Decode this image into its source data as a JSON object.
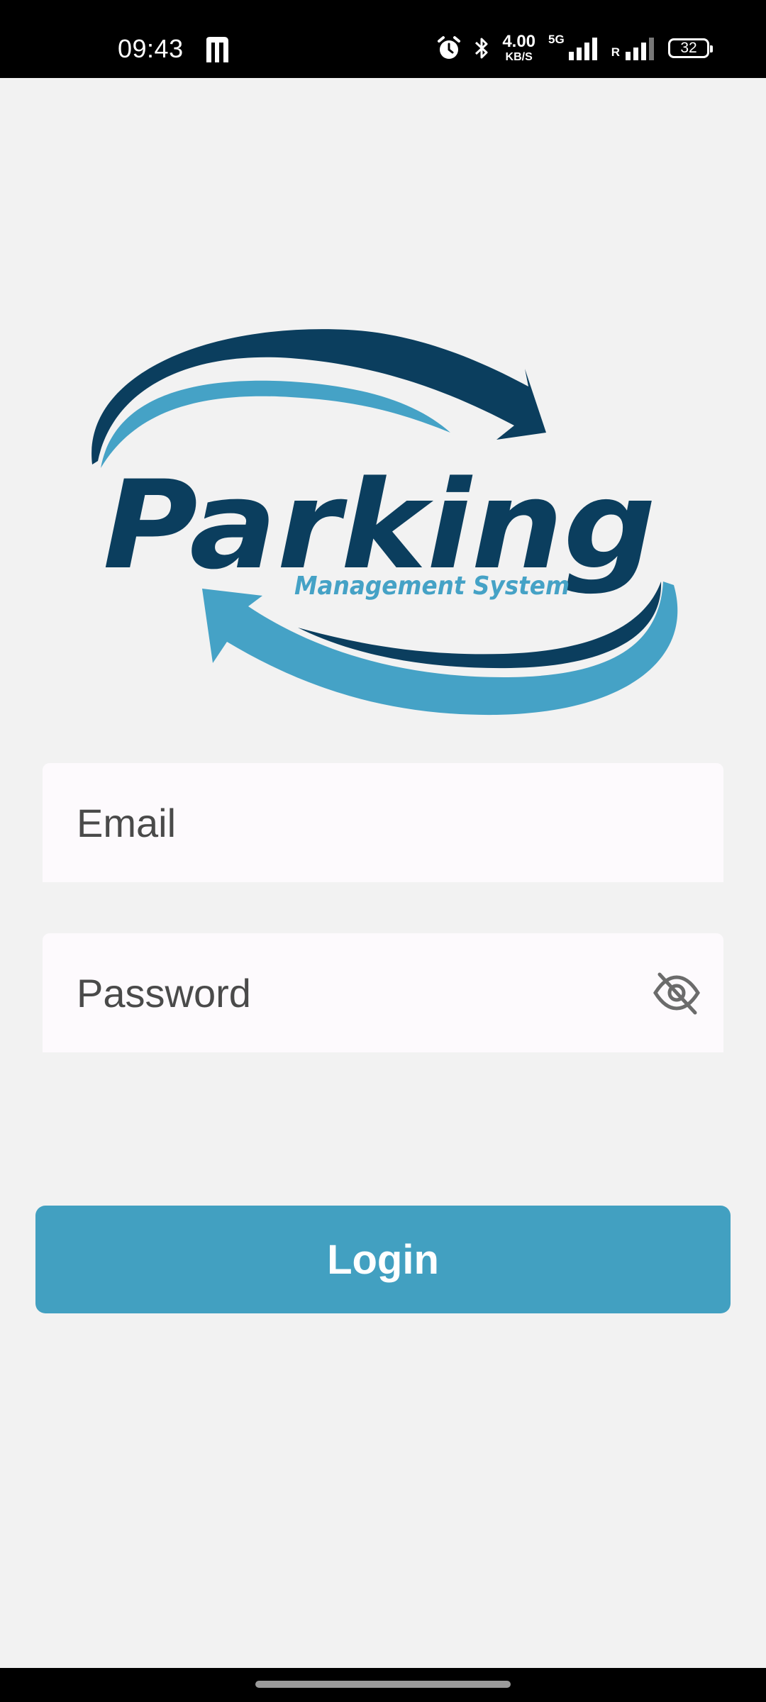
{
  "status_bar": {
    "time": "09:43",
    "app_icon": "m-logo-icon",
    "icons": [
      "alarm-icon",
      "bluetooth-icon",
      "signal-icon",
      "signal-roaming-icon",
      "battery-icon"
    ],
    "net_speed_value": "4.00",
    "net_speed_unit": "KB/S",
    "network_type": "5G",
    "roaming_label": "R",
    "battery_level": "32"
  },
  "logo": {
    "word": "Parking",
    "tagline": "Management System",
    "colors": {
      "dark": "#0b3e5e",
      "light": "#45a2c6"
    }
  },
  "form": {
    "email": {
      "placeholder": "Email",
      "value": ""
    },
    "password": {
      "placeholder": "Password",
      "value": "",
      "toggle_icon": "eye-off-icon"
    },
    "login_label": "Login"
  },
  "colors": {
    "accent": "#42a0c1",
    "background": "#f2f2f2",
    "field_background": "#fdfafd"
  }
}
